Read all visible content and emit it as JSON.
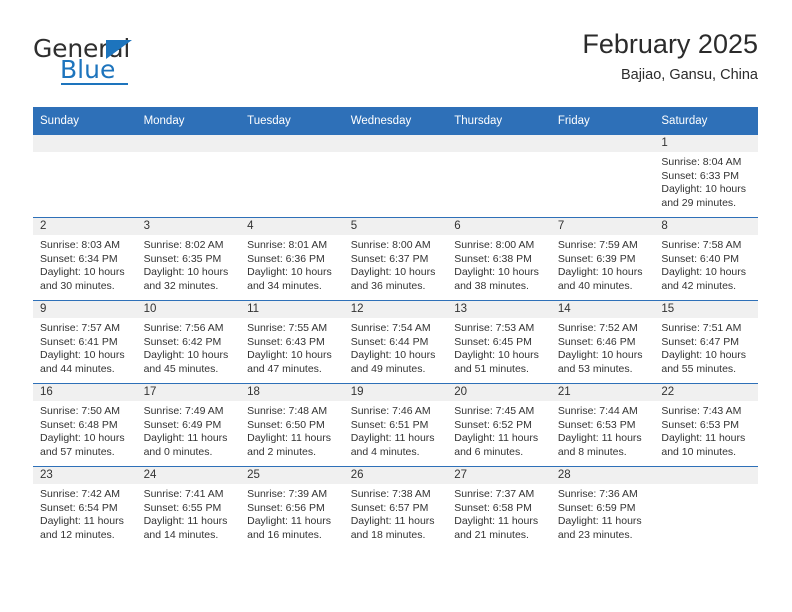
{
  "logo": {
    "text_primary": "General",
    "text_secondary": "Blue",
    "triangle_icon": "triangle-icon",
    "primary_color": "#2f2f2f",
    "secondary_color": "#1d74bd"
  },
  "header": {
    "month_title": "February 2025",
    "location": "Bajiao, Gansu, China"
  },
  "theme": {
    "header_blue": "#2e70b8",
    "daynum_band_gray": "#f0f0f0",
    "text_color": "#333333",
    "page_background": "#ffffff"
  },
  "calendar": {
    "weekday_headers": [
      "Sunday",
      "Monday",
      "Tuesday",
      "Wednesday",
      "Thursday",
      "Friday",
      "Saturday"
    ],
    "weeks": [
      [
        {
          "day": "",
          "blank": true
        },
        {
          "day": "",
          "blank": true
        },
        {
          "day": "",
          "blank": true
        },
        {
          "day": "",
          "blank": true
        },
        {
          "day": "",
          "blank": true
        },
        {
          "day": "",
          "blank": true
        },
        {
          "day": "1",
          "sunrise": "Sunrise: 8:04 AM",
          "sunset": "Sunset: 6:33 PM",
          "daylight": "Daylight: 10 hours and 29 minutes."
        }
      ],
      [
        {
          "day": "2",
          "sunrise": "Sunrise: 8:03 AM",
          "sunset": "Sunset: 6:34 PM",
          "daylight": "Daylight: 10 hours and 30 minutes."
        },
        {
          "day": "3",
          "sunrise": "Sunrise: 8:02 AM",
          "sunset": "Sunset: 6:35 PM",
          "daylight": "Daylight: 10 hours and 32 minutes."
        },
        {
          "day": "4",
          "sunrise": "Sunrise: 8:01 AM",
          "sunset": "Sunset: 6:36 PM",
          "daylight": "Daylight: 10 hours and 34 minutes."
        },
        {
          "day": "5",
          "sunrise": "Sunrise: 8:00 AM",
          "sunset": "Sunset: 6:37 PM",
          "daylight": "Daylight: 10 hours and 36 minutes."
        },
        {
          "day": "6",
          "sunrise": "Sunrise: 8:00 AM",
          "sunset": "Sunset: 6:38 PM",
          "daylight": "Daylight: 10 hours and 38 minutes."
        },
        {
          "day": "7",
          "sunrise": "Sunrise: 7:59 AM",
          "sunset": "Sunset: 6:39 PM",
          "daylight": "Daylight: 10 hours and 40 minutes."
        },
        {
          "day": "8",
          "sunrise": "Sunrise: 7:58 AM",
          "sunset": "Sunset: 6:40 PM",
          "daylight": "Daylight: 10 hours and 42 minutes."
        }
      ],
      [
        {
          "day": "9",
          "sunrise": "Sunrise: 7:57 AM",
          "sunset": "Sunset: 6:41 PM",
          "daylight": "Daylight: 10 hours and 44 minutes."
        },
        {
          "day": "10",
          "sunrise": "Sunrise: 7:56 AM",
          "sunset": "Sunset: 6:42 PM",
          "daylight": "Daylight: 10 hours and 45 minutes."
        },
        {
          "day": "11",
          "sunrise": "Sunrise: 7:55 AM",
          "sunset": "Sunset: 6:43 PM",
          "daylight": "Daylight: 10 hours and 47 minutes."
        },
        {
          "day": "12",
          "sunrise": "Sunrise: 7:54 AM",
          "sunset": "Sunset: 6:44 PM",
          "daylight": "Daylight: 10 hours and 49 minutes."
        },
        {
          "day": "13",
          "sunrise": "Sunrise: 7:53 AM",
          "sunset": "Sunset: 6:45 PM",
          "daylight": "Daylight: 10 hours and 51 minutes."
        },
        {
          "day": "14",
          "sunrise": "Sunrise: 7:52 AM",
          "sunset": "Sunset: 6:46 PM",
          "daylight": "Daylight: 10 hours and 53 minutes."
        },
        {
          "day": "15",
          "sunrise": "Sunrise: 7:51 AM",
          "sunset": "Sunset: 6:47 PM",
          "daylight": "Daylight: 10 hours and 55 minutes."
        }
      ],
      [
        {
          "day": "16",
          "sunrise": "Sunrise: 7:50 AM",
          "sunset": "Sunset: 6:48 PM",
          "daylight": "Daylight: 10 hours and 57 minutes."
        },
        {
          "day": "17",
          "sunrise": "Sunrise: 7:49 AM",
          "sunset": "Sunset: 6:49 PM",
          "daylight": "Daylight: 11 hours and 0 minutes."
        },
        {
          "day": "18",
          "sunrise": "Sunrise: 7:48 AM",
          "sunset": "Sunset: 6:50 PM",
          "daylight": "Daylight: 11 hours and 2 minutes."
        },
        {
          "day": "19",
          "sunrise": "Sunrise: 7:46 AM",
          "sunset": "Sunset: 6:51 PM",
          "daylight": "Daylight: 11 hours and 4 minutes."
        },
        {
          "day": "20",
          "sunrise": "Sunrise: 7:45 AM",
          "sunset": "Sunset: 6:52 PM",
          "daylight": "Daylight: 11 hours and 6 minutes."
        },
        {
          "day": "21",
          "sunrise": "Sunrise: 7:44 AM",
          "sunset": "Sunset: 6:53 PM",
          "daylight": "Daylight: 11 hours and 8 minutes."
        },
        {
          "day": "22",
          "sunrise": "Sunrise: 7:43 AM",
          "sunset": "Sunset: 6:53 PM",
          "daylight": "Daylight: 11 hours and 10 minutes."
        }
      ],
      [
        {
          "day": "23",
          "sunrise": "Sunrise: 7:42 AM",
          "sunset": "Sunset: 6:54 PM",
          "daylight": "Daylight: 11 hours and 12 minutes."
        },
        {
          "day": "24",
          "sunrise": "Sunrise: 7:41 AM",
          "sunset": "Sunset: 6:55 PM",
          "daylight": "Daylight: 11 hours and 14 minutes."
        },
        {
          "day": "25",
          "sunrise": "Sunrise: 7:39 AM",
          "sunset": "Sunset: 6:56 PM",
          "daylight": "Daylight: 11 hours and 16 minutes."
        },
        {
          "day": "26",
          "sunrise": "Sunrise: 7:38 AM",
          "sunset": "Sunset: 6:57 PM",
          "daylight": "Daylight: 11 hours and 18 minutes."
        },
        {
          "day": "27",
          "sunrise": "Sunrise: 7:37 AM",
          "sunset": "Sunset: 6:58 PM",
          "daylight": "Daylight: 11 hours and 21 minutes."
        },
        {
          "day": "28",
          "sunrise": "Sunrise: 7:36 AM",
          "sunset": "Sunset: 6:59 PM",
          "daylight": "Daylight: 11 hours and 23 minutes."
        },
        {
          "day": "",
          "blank": true
        }
      ]
    ]
  }
}
